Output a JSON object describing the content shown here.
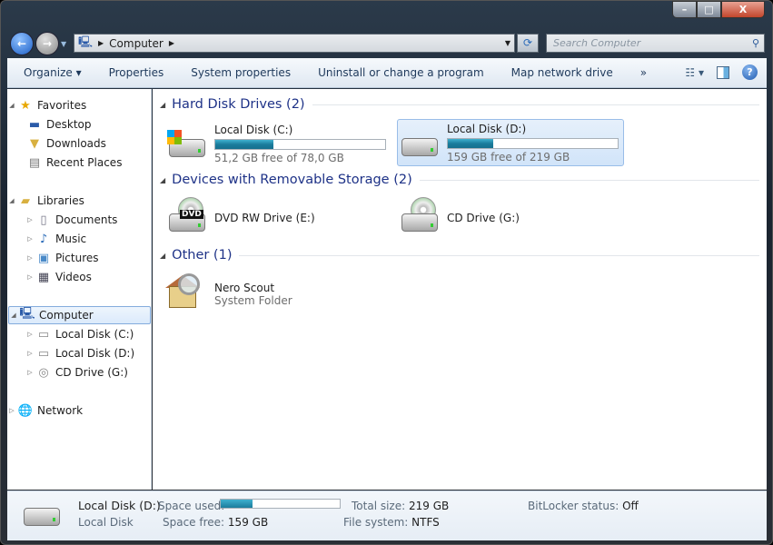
{
  "window": {
    "minimize": "–",
    "maximize": "□",
    "close": "X"
  },
  "nav": {
    "address": [
      "Computer"
    ],
    "search_placeholder": "Search Computer"
  },
  "toolbar": {
    "items": [
      "Organize ▾",
      "Properties",
      "System properties",
      "Uninstall or change a program",
      "Map network drive",
      "»"
    ],
    "help": "?"
  },
  "sidebar": {
    "favorites": {
      "label": "Favorites",
      "items": [
        "Desktop",
        "Downloads",
        "Recent Places"
      ]
    },
    "libraries": {
      "label": "Libraries",
      "items": [
        "Documents",
        "Music",
        "Pictures",
        "Videos"
      ]
    },
    "computer": {
      "label": "Computer",
      "items": [
        "Local Disk (C:)",
        "Local Disk (D:)",
        "CD Drive (G:)"
      ]
    },
    "network": {
      "label": "Network"
    }
  },
  "main": {
    "groups": [
      {
        "title": "Hard Disk Drives (2)",
        "items": [
          {
            "name": "Local Disk (C:)",
            "sub": "51,2 GB free of 78,0 GB",
            "used_percent": 34
          },
          {
            "name": "Local Disk (D:)",
            "sub": "159 GB free of 219 GB",
            "used_percent": 27,
            "selected": true
          }
        ]
      },
      {
        "title": "Devices with Removable Storage (2)",
        "items": [
          {
            "name": "DVD RW Drive (E:)",
            "badge": "DVD"
          },
          {
            "name": "CD Drive (G:)"
          }
        ]
      },
      {
        "title": "Other (1)",
        "items": [
          {
            "name": "Nero Scout",
            "sub": "System Folder"
          }
        ]
      }
    ]
  },
  "details": {
    "name": "Local Disk (D:)",
    "type": "Local Disk",
    "space_used_label": "Space used:",
    "space_used_percent": 27,
    "space_free_label": "Space free:",
    "space_free": "159 GB",
    "total_size_label": "Total size:",
    "total_size": "219 GB",
    "file_system_label": "File system:",
    "file_system": "NTFS",
    "bitlocker_label": "BitLocker status:",
    "bitlocker": "Off"
  },
  "colors": {
    "accent": "#1e3287",
    "bar_fill": "#1b7c9c",
    "selection": "#d1e4f9"
  }
}
